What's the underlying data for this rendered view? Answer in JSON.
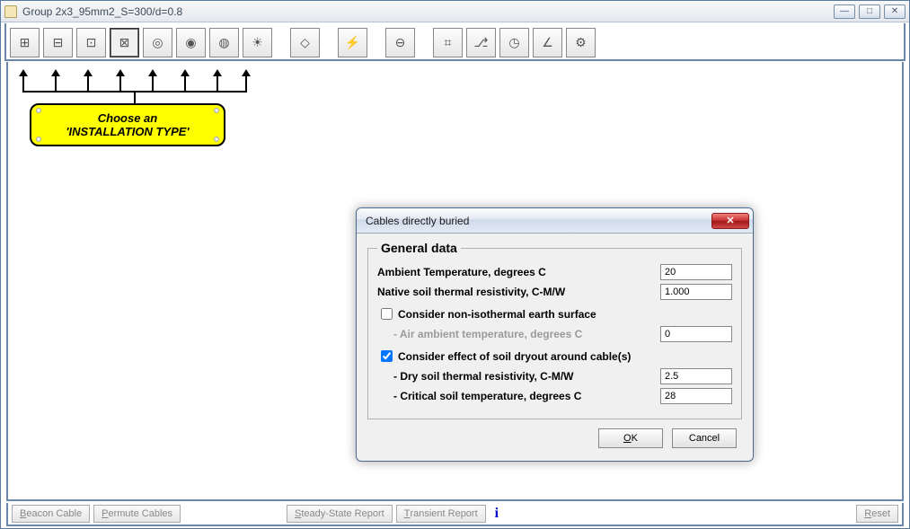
{
  "window": {
    "title": "Group 2x3_95mm2_S=300/d=0.8"
  },
  "callout": {
    "line1": "Choose an",
    "line2": "'INSTALLATION TYPE'"
  },
  "toolbar": {
    "items": [
      {
        "name": "install-type-1",
        "glyph": "⊞"
      },
      {
        "name": "install-type-2",
        "glyph": "⊟"
      },
      {
        "name": "install-type-3",
        "glyph": "⊡"
      },
      {
        "name": "install-type-4-selected",
        "glyph": "⊠"
      },
      {
        "name": "install-type-5",
        "glyph": "◎"
      },
      {
        "name": "install-type-6",
        "glyph": "◉"
      },
      {
        "name": "install-type-7",
        "glyph": "◍"
      },
      {
        "name": "install-type-sun",
        "glyph": "☀"
      }
    ],
    "group2": [
      {
        "name": "diamond-icon",
        "glyph": "◇"
      },
      {
        "name": "bolt-icon",
        "glyph": "⚡"
      },
      {
        "name": "zoom-icon",
        "glyph": "⊖"
      },
      {
        "name": "axes1-icon",
        "glyph": "⌗"
      },
      {
        "name": "axes2-icon",
        "glyph": "⎇"
      },
      {
        "name": "compass-icon",
        "glyph": "◷"
      },
      {
        "name": "angle-icon",
        "glyph": "∠"
      },
      {
        "name": "gear-icon",
        "glyph": "⚙"
      }
    ]
  },
  "dialog": {
    "title": "Cables directly buried",
    "legend": "General data",
    "rows": {
      "ambient_label": "Ambient Temperature, degrees C",
      "ambient_val": "20",
      "native_label": "Native soil thermal resistivity, C-M/W",
      "native_val": "1.000",
      "chk1_label": "Consider non-isothermal earth surface",
      "air_label": "- Air ambient temperature, degrees C",
      "air_val": "0",
      "chk2_label": "Consider effect of soil dryout around cable(s)",
      "dry_label": "- Dry soil thermal resistivity, C-M/W",
      "dry_val": "2.5",
      "crit_label": "- Critical soil temperature, degrees C",
      "crit_val": "28"
    },
    "ok_u": "O",
    "ok_rest": "K",
    "cancel": "Cancel"
  },
  "bottom": {
    "beacon_u": "B",
    "beacon_rest": "eacon Cable",
    "permute_u": "P",
    "permute_rest": "ermute Cables",
    "ssr_u": "S",
    "ssr_rest": "teady-State Report",
    "tr_u": "T",
    "tr_rest": "ransient Report",
    "reset_u": "R",
    "reset_rest": "eset"
  }
}
